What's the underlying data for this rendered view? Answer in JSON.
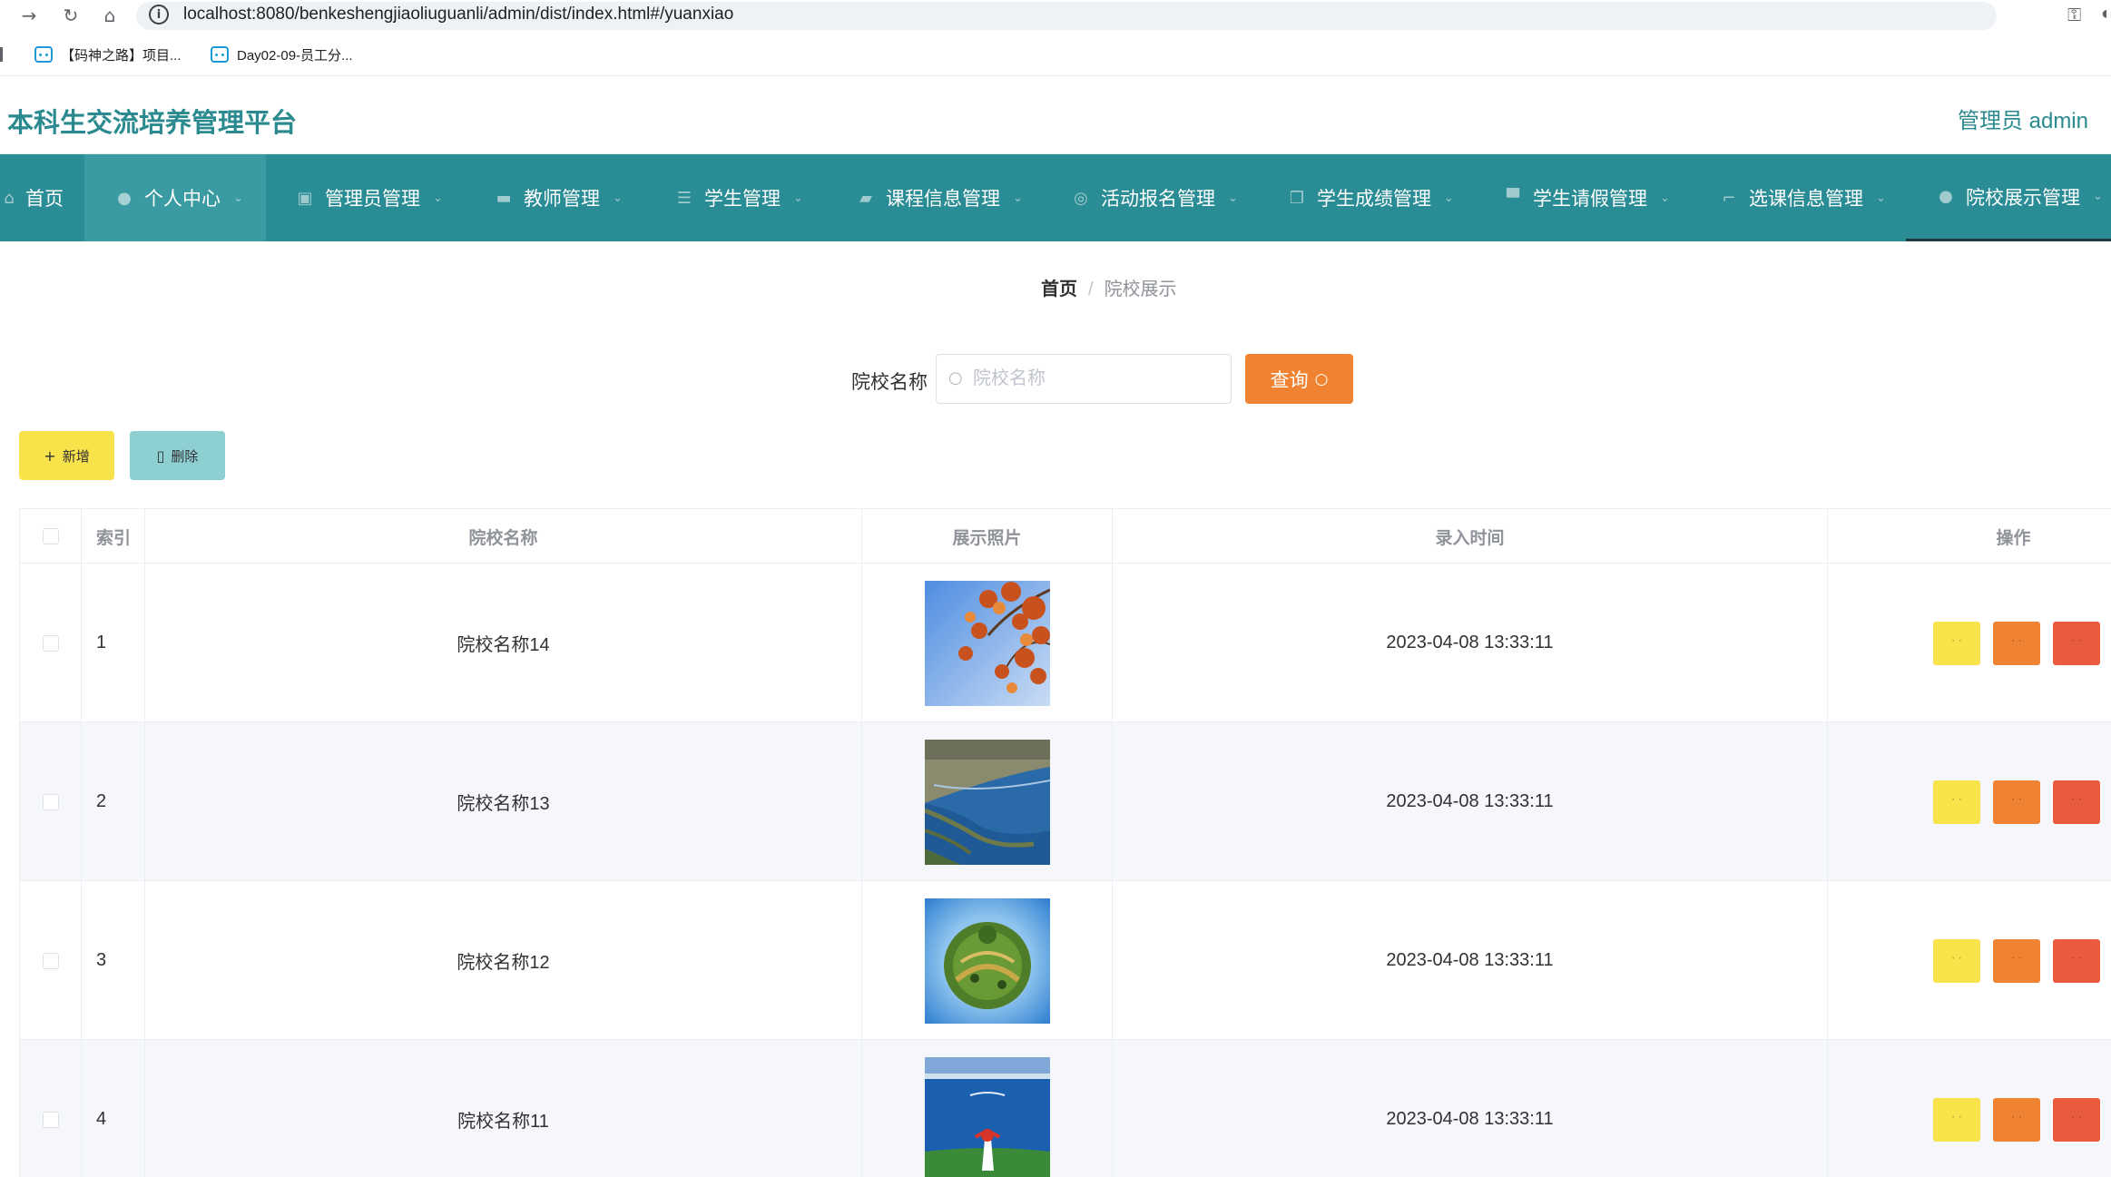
{
  "browser": {
    "url": "localhost:8080/benkeshengjiaoliuguanli/admin/dist/index.html#/yuanxiao",
    "bookmarks": [
      {
        "label": "【码神之路】项目..."
      },
      {
        "label": "Day02-09-员工分..."
      }
    ]
  },
  "app": {
    "title": "本科生交流培养管理平台",
    "user_label": "管理员 admin"
  },
  "nav": {
    "items": [
      {
        "label": "首页",
        "icon": "home-icon"
      },
      {
        "label": "个人中心",
        "icon": "user-icon"
      },
      {
        "label": "管理员管理",
        "icon": "clipboard-icon"
      },
      {
        "label": "教师管理",
        "icon": "chat-icon"
      },
      {
        "label": "学生管理",
        "icon": "sliders-icon"
      },
      {
        "label": "课程信息管理",
        "icon": "wallet-icon"
      },
      {
        "label": "活动报名管理",
        "icon": "compass-icon"
      },
      {
        "label": "学生成绩管理",
        "icon": "copy-icon"
      },
      {
        "label": "学生请假管理",
        "icon": "printer-icon"
      },
      {
        "label": "选课信息管理",
        "icon": "crop-icon"
      },
      {
        "label": "院校展示管理",
        "icon": "location-icon"
      }
    ]
  },
  "breadcrumb": {
    "home": "首页",
    "separator": "/",
    "current": "院校展示"
  },
  "search": {
    "label": "院校名称",
    "placeholder": "院校名称",
    "value": "",
    "button_label": "查询"
  },
  "actions": {
    "add_label": "新增",
    "delete_label": "删除"
  },
  "table": {
    "columns": [
      "索引",
      "院校名称",
      "展示照片",
      "录入时间",
      "操作"
    ],
    "rows": [
      {
        "index": "1",
        "name": "院校名称14",
        "photo": "autumn-leaves-photo",
        "time": "2023-04-08 13:33:11"
      },
      {
        "index": "2",
        "name": "院校名称13",
        "photo": "coastline-photo",
        "time": "2023-04-08 13:33:11"
      },
      {
        "index": "3",
        "name": "院校名称12",
        "photo": "tiny-planet-photo",
        "time": "2023-04-08 13:33:11"
      },
      {
        "index": "4",
        "name": "院校名称11",
        "photo": "lake-photo",
        "time": "2023-04-08 13:33:11"
      }
    ]
  },
  "colors": {
    "brand": "#2b8a8f",
    "nav_bg": "#2a8c94",
    "search_button": "#f08332",
    "add_button": "#f9e34b",
    "delete_button": "#8ecfd2",
    "op_yellow": "#f9e34b",
    "op_orange": "#f08332",
    "op_red": "#ea5a3d"
  }
}
